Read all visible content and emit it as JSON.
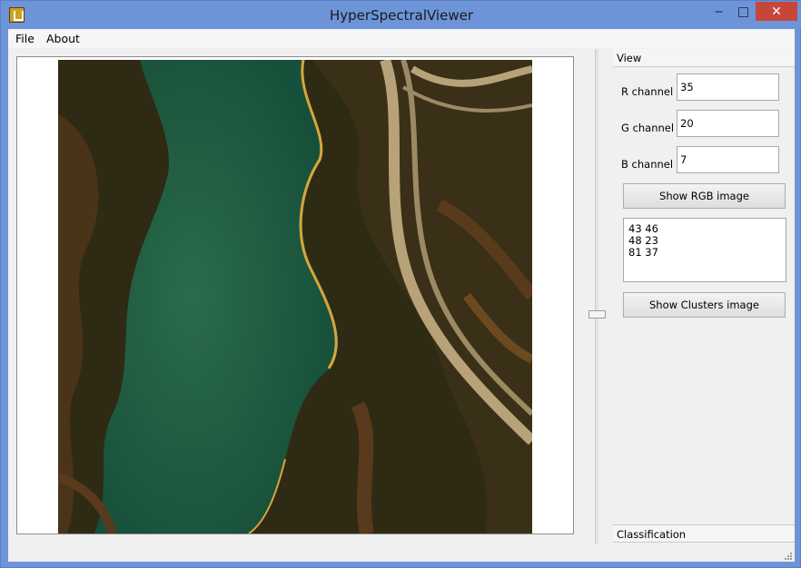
{
  "window": {
    "title": "HyperSpectralViewer",
    "minimize": "‒",
    "maximize": "□",
    "close": "✕"
  },
  "menu": {
    "items": [
      "File",
      "About"
    ]
  },
  "view_panel": {
    "header": "View",
    "r_label": "R channel",
    "r_value": "35",
    "g_label": "G channel",
    "g_value": "20",
    "b_label": "B channel",
    "b_value": "7",
    "show_rgb_button": "Show RGB image",
    "clusters_lines": [
      "43 46",
      "48 23",
      "81 37"
    ],
    "show_clusters_button": "Show Clusters image"
  },
  "classification_panel": {
    "header": "Classification"
  },
  "colors": {
    "title_bar": "#6d94d8",
    "close_button": "#c7463a",
    "water": "#1f5a3c",
    "land_dark": "#2f2a14",
    "land_brown": "#5a3a1c",
    "road": "#b8a27a",
    "shore_yellow": "#d9a53a"
  }
}
